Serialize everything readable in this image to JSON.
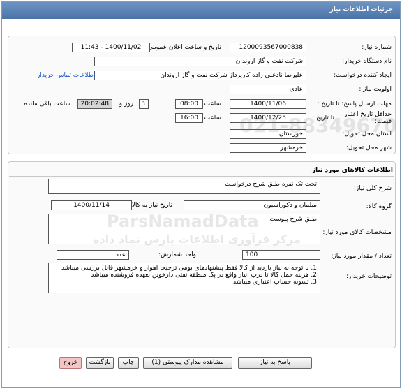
{
  "header": {
    "title": "جزئیات اطلاعات نیاز"
  },
  "need_info": {
    "need_number_label": "شماره نیاز:",
    "need_number": "1200093567000838",
    "announce_label": "تاریخ و ساعت اعلان عمومی:",
    "announce_value": "1400/11/02 - 11:43",
    "buyer_org_label": "نام دستگاه خریدار:",
    "buyer_org": "شرکت نفت و گاز اروندان",
    "creator_label": "ایجاد کننده درخواست:",
    "creator": "علیرضا نادعلی زاده کارپرداز شرکت نفت و گاز اروندان",
    "contact_link": "اطلاعات تماس خریدار",
    "priority_label": "اولویت نیاز :",
    "priority": "عادی",
    "deadline_label": "مهلت ارسال پاسخ: تا تاریخ :",
    "deadline_date": "1400/11/06",
    "time_label": "ساعت",
    "deadline_time": "08:00",
    "days_value": "3",
    "days_and_label": "روز و",
    "remaining_time": "20:02:48",
    "remaining_label": "ساعت باقی مانده",
    "min_validity_label_1": "حداقل تاریخ اعتبار",
    "min_validity_label_2": "قیمت:",
    "until_date_label": "تا تاریخ :",
    "validity_date": "1400/12/25",
    "validity_time": "16:00",
    "province_label": "استان محل تحویل:",
    "province": "خوزستان",
    "city_label": "شهر محل تحویل:",
    "city": "خرمشهر"
  },
  "goods_info": {
    "section_title": "اطلاعات کالاهای مورد نیاز",
    "general_desc_label": "شرح کلی نیاز:",
    "general_desc": "تخت تک نفره طبق شرح درخواست",
    "group_label": "گروه کالا:",
    "group": "مبلمان و دکوراسیون",
    "need_date_label": "تاریخ نیاز به کالا:",
    "need_date": "1400/11/14",
    "specs_label": "مشخصات کالای مورد نیاز:",
    "specs": "طبق شرح پیوست",
    "qty_label": "تعداد / مقدار مورد نیاز:",
    "qty": "100",
    "unit_label": "واحد شمارش:",
    "unit": "عدد",
    "buyer_notes_label": "توضیحات خریدار:",
    "buyer_notes": [
      "1. با توجه به نیاز بازدید از کالا فقط پیشنهادهای بومی ترجیحا اهواز و خرمشهر قابل بررسی میباشد",
      "2. هزینه حمل کالا تا درب انبار واقع در پک منطقه نفتی دارخوین بعهده فروشنده میباشد",
      "3. تسویه حساب اعتباری میباشد"
    ]
  },
  "buttons": {
    "reply": "پاسخ به نیاز",
    "attachments": "مشاهده مدارک پیوستی (1)",
    "print": "چاپ",
    "back": "بازگشت",
    "exit": "خروج"
  },
  "watermark": {
    "main": "ParsNamadData",
    "sub": "مرکز فرآوری اطلاعات پارس نماد داده",
    "phone": "021-88349670"
  }
}
